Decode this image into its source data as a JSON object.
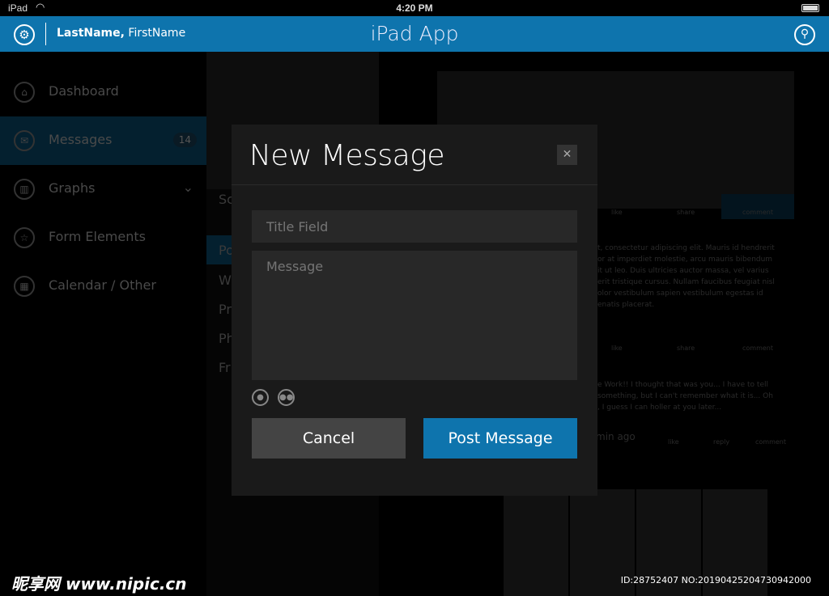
{
  "status_bar": {
    "carrier": "iPad",
    "time": "4:20 PM"
  },
  "header": {
    "user_last": "LastName,",
    "user_first": "FirstName",
    "title": "iPad App",
    "settings_icon": "gear-icon",
    "search_icon": "search-icon"
  },
  "sidebar": {
    "items": [
      {
        "label": "Dashboard",
        "icon": "home-icon"
      },
      {
        "label": "Messages",
        "icon": "envelope-icon",
        "badge": "14",
        "active": true
      },
      {
        "label": "Graphs",
        "icon": "bar-chart-icon"
      },
      {
        "label": "Form Elements",
        "icon": "star-icon"
      },
      {
        "label": "Calendar / Other",
        "icon": "calendar-icon"
      }
    ]
  },
  "subnav": {
    "search": "Sc",
    "items": [
      "Po",
      "W",
      "Pr",
      "Ph",
      "Fr"
    ]
  },
  "feed": {
    "post_text": [
      "t, consectetur adipiscing elit. Mauris id hendrerit",
      "or at imperdiet molestie, arcu mauris bibendum",
      "it ut leo. Duis ultricies auctor massa, vel varius",
      "erit tristique cursus. Nullam faucibus feugiat nisl",
      "olor vestibulum sapien vestibulum egestas id",
      "enatis placerat."
    ],
    "comment_text": [
      "e Work!! I thought that was you... I have to tell",
      "something, but I can't remember what it is... Oh",
      ", I guess I can holler at you later..."
    ],
    "time": "min ago",
    "actions": {
      "like": "like",
      "share": "share",
      "comment": "comment",
      "reply": "reply"
    }
  },
  "modal": {
    "title": "New Message",
    "title_placeholder": "Title Field",
    "message_placeholder": "Message",
    "cancel": "Cancel",
    "post": "Post Message"
  },
  "watermark": {
    "logo": "昵享网 www.nipic.cn",
    "id": "ID:28752407 NO:20190425204730942000"
  },
  "colors": {
    "accent": "#0e74ad",
    "modal_bg": "#1a1a1a",
    "field_bg": "#282828",
    "cancel_bg": "#444444"
  }
}
